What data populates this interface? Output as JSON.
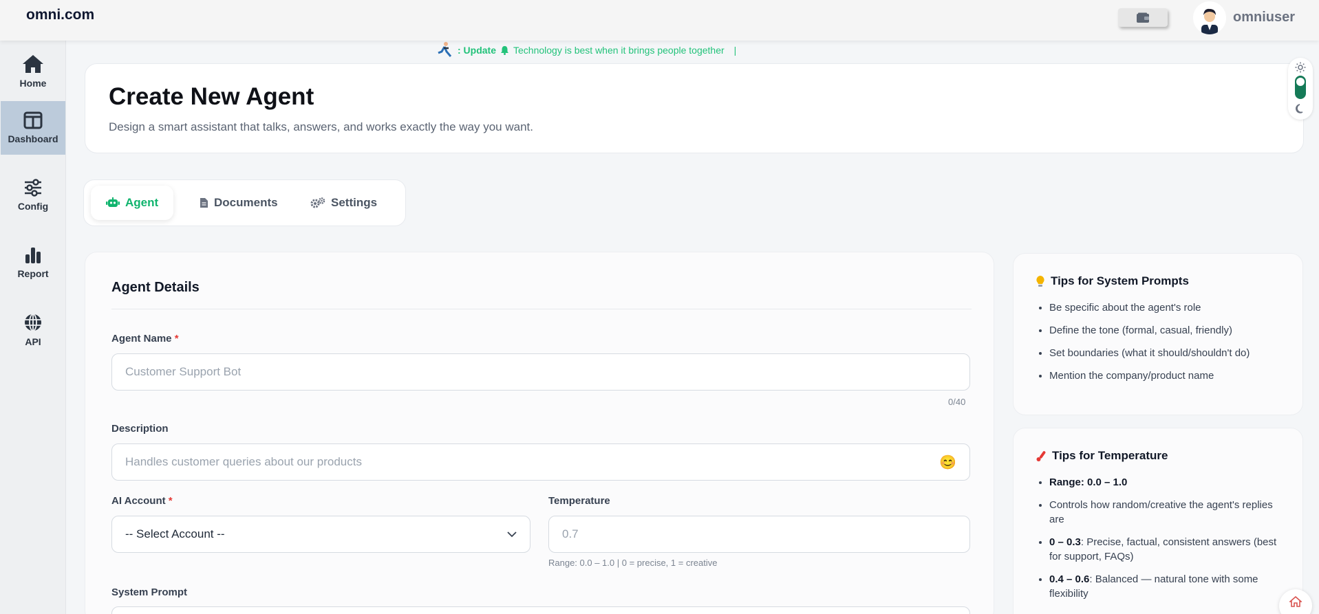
{
  "header": {
    "logo": "omni.com",
    "username": "omniuser"
  },
  "sidebar": {
    "items": [
      {
        "label": "Home",
        "icon": "home-icon"
      },
      {
        "label": "Dashboard",
        "icon": "dashboard-icon",
        "active": true
      },
      {
        "label": "Config",
        "icon": "sliders-icon"
      },
      {
        "label": "Report",
        "icon": "bar-chart-icon"
      },
      {
        "label": "API",
        "icon": "globe-icon"
      }
    ]
  },
  "ticker": {
    "prefix": ": Update",
    "message": "Technology is best when it brings people together",
    "cursor": "|"
  },
  "page": {
    "title": "Create New Agent",
    "subtitle": "Design a smart assistant that talks, answers, and works exactly the way you want."
  },
  "tabs": [
    {
      "label": "Agent",
      "icon": "robot-icon",
      "active": true
    },
    {
      "label": "Documents",
      "icon": "document-icon"
    },
    {
      "label": "Settings",
      "icon": "gears-icon"
    }
  ],
  "form": {
    "section_title": "Agent Details",
    "agent_name": {
      "label": "Agent Name",
      "required": "*",
      "placeholder": "Customer Support Bot",
      "counter": "0/40"
    },
    "description": {
      "label": "Description",
      "placeholder": "Handles customer queries about our products",
      "emoji": "😊"
    },
    "ai_account": {
      "label": "AI Account",
      "required": "*",
      "selected": "-- Select Account --"
    },
    "temperature": {
      "label": "Temperature",
      "placeholder": "0.7",
      "hint": "Range: 0.0 – 1.0 | 0 = precise, 1 = creative"
    },
    "system_prompt": {
      "label": "System Prompt"
    }
  },
  "tips_prompts": {
    "title": "Tips for System Prompts",
    "items": [
      "Be specific about the agent's role",
      "Define the tone (formal, casual, friendly)",
      "Set boundaries (what it should/shouldn't do)",
      "Mention the company/product name"
    ]
  },
  "tips_temperature": {
    "title": "Tips for Temperature",
    "range": "Range: 0.0 – 1.0",
    "item_controls": "Controls how random/creative the agent's replies are",
    "low_key": "0 – 0.3",
    "low_text": ": Precise, factual, consistent answers (best for support, FAQs)",
    "mid_key": "0.4 – 0.6",
    "mid_text": ": Balanced — natural tone with some flexibility"
  },
  "colors": {
    "accent": "#10b46e",
    "sidebar_active": "#bccbdb",
    "required": "#e53935"
  }
}
